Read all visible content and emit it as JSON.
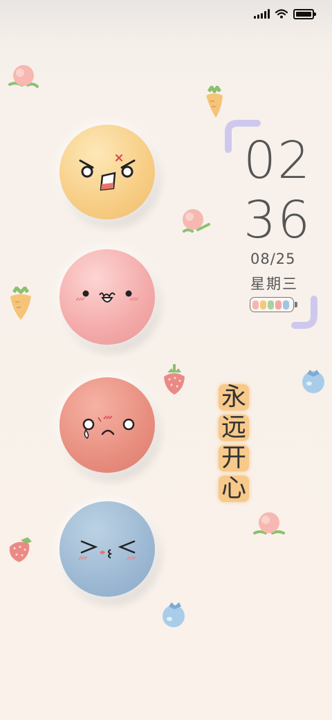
{
  "status_bar": {
    "signal_icon": "signal-bars-icon",
    "wifi_icon": "wifi-icon",
    "battery_icon": "battery-full-icon"
  },
  "clock": {
    "hour": "02",
    "minute": "36",
    "date": "08/25",
    "weekday": "星期三"
  },
  "battery_widget": {
    "segment_colors": [
      "#f4b7b0",
      "#f4c97e",
      "#a9d39b",
      "#f3a7a4",
      "#9ec4e6"
    ]
  },
  "motto": [
    "永",
    "远",
    "开",
    "心"
  ],
  "faces": [
    "angry-face",
    "surprised-face",
    "crying-face",
    "squinting-kiss-face"
  ],
  "decorations": [
    "peach-icon",
    "carrot-icon",
    "strawberry-icon",
    "blueberry-icon"
  ],
  "colors": {
    "background": "#f9f1ea",
    "yellow_blob": "#f7cd84",
    "pink_blob": "#f3aaa9",
    "coral_blob": "#e88e7f",
    "blue_blob": "#9cb8d3",
    "bracket": "#cfc8ee"
  }
}
